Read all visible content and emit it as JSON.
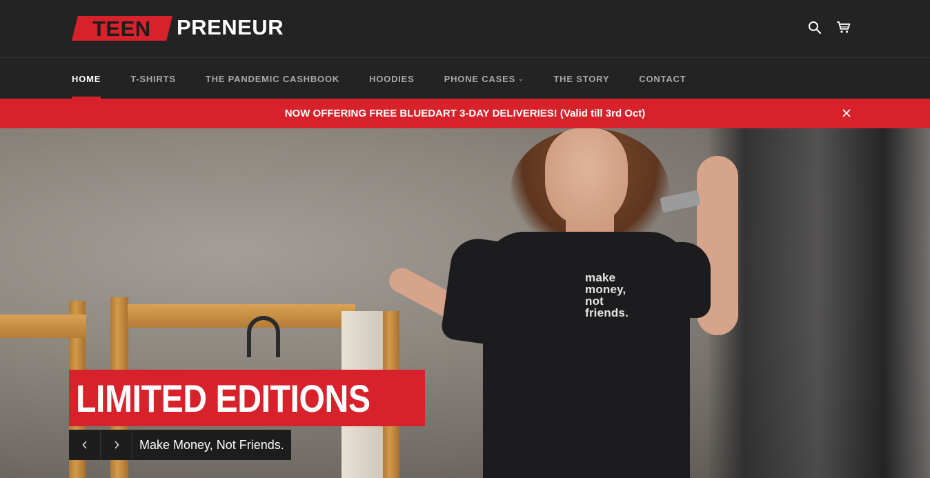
{
  "brand": {
    "logo_part1": "TEEN",
    "logo_part2": "PRENEUR",
    "accent_color": "#d8222b",
    "header_bg": "#232323"
  },
  "header": {
    "icons": [
      "search-icon",
      "cart-icon"
    ]
  },
  "nav": {
    "items": [
      {
        "label": "HOME",
        "active": true
      },
      {
        "label": "T-SHIRTS",
        "active": false
      },
      {
        "label": "THE PANDEMIC CASHBOOK",
        "active": false
      },
      {
        "label": "HOODIES",
        "active": false
      },
      {
        "label": "PHONE CASES",
        "active": false,
        "has_dropdown": true
      },
      {
        "label": "THE STORY",
        "active": false
      },
      {
        "label": "CONTACT",
        "active": false
      }
    ]
  },
  "announcement": {
    "text": "NOW OFFERING FREE BLUEDART 3-DAY DELIVERIES! (Valid till 3rd Oct)",
    "close_icon": "close-icon"
  },
  "hero": {
    "title": "LIMITED EDITIONS",
    "caption": "Make Money, Not Friends.",
    "prev_icon": "chevron-left-icon",
    "next_icon": "chevron-right-icon",
    "shirt_print": [
      "make",
      "money,",
      "not",
      "friends."
    ]
  }
}
